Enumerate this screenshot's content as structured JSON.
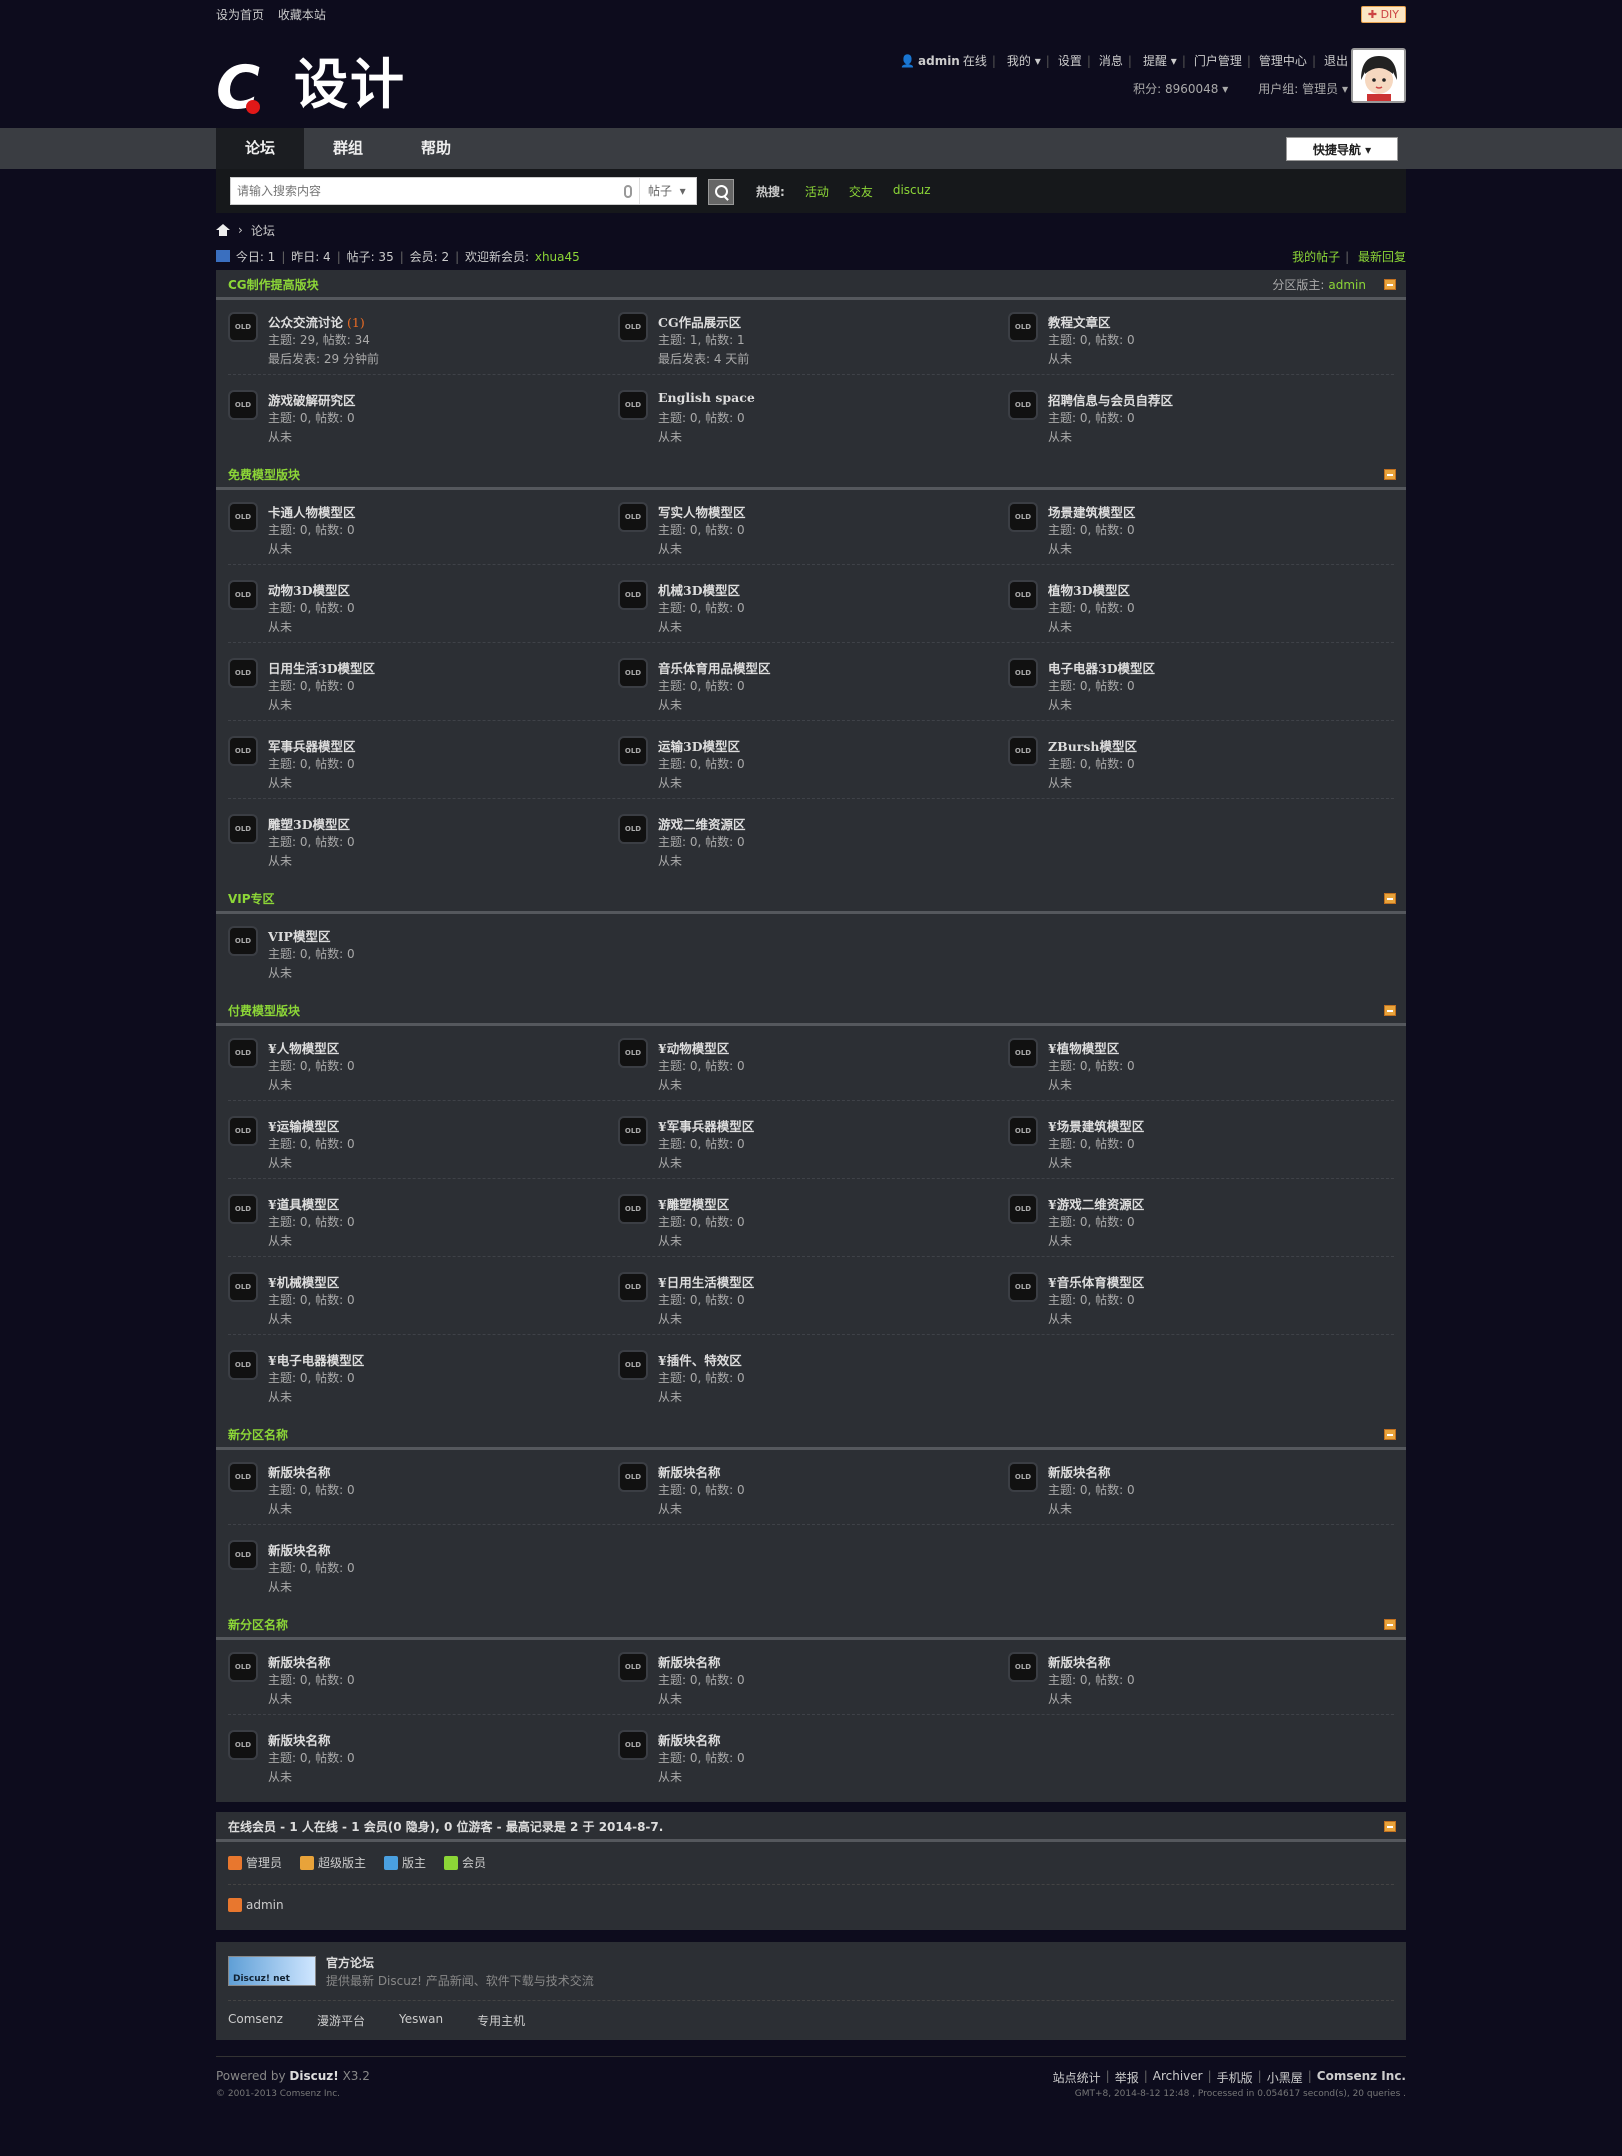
{
  "topbar": {
    "set_home": "设为首页",
    "bookmark": "收藏本站",
    "diy": "DIY"
  },
  "logo": {
    "mark": "C",
    "text": "设计"
  },
  "user": {
    "name": "admin",
    "status": "在线",
    "my": "我的",
    "settings": "设置",
    "messages": "消息",
    "alerts": "提醒",
    "portal_admin": "门户管理",
    "admin_center": "管理中心",
    "logout": "退出",
    "points": "积分: 8960048",
    "group": "用户组: 管理员"
  },
  "nav": {
    "tabs": [
      "论坛",
      "群组",
      "帮助"
    ],
    "quicknav": "快捷导航"
  },
  "search": {
    "placeholder": "请输入搜索内容",
    "type": "帖子",
    "hot_label": "热搜:",
    "hot": [
      "活动",
      "交友",
      "discuz"
    ]
  },
  "breadcrumb": {
    "sep": "›",
    "current": "论坛"
  },
  "stats": {
    "today": "今日: 1",
    "yesterday": "昨日: 4",
    "posts": "帖子: 35",
    "members": "会员: 2",
    "welcome": "欢迎新会员:",
    "newest": "xhua45",
    "my_posts": "我的帖子",
    "latest": "最新回复"
  },
  "categories": [
    {
      "title": "CG制作提高版块",
      "moderator_label": "分区版主:",
      "moderator": "admin",
      "forums": [
        {
          "name": "公众交流讨论",
          "new": "(1)",
          "meta": "主题: 29, 帖数: 34",
          "last": "最后发表: 29 分钟前"
        },
        {
          "name": "CG作品展示区",
          "new": "",
          "meta": "主题: 1, 帖数: 1",
          "last": "最后发表: 4 天前"
        },
        {
          "name": "教程文章区",
          "new": "",
          "meta": "主题: 0, 帖数: 0",
          "last": "从未"
        },
        {
          "name": "游戏破解研究区",
          "new": "",
          "meta": "主题: 0, 帖数: 0",
          "last": "从未"
        },
        {
          "name": "English space",
          "new": "",
          "meta": "主题: 0, 帖数: 0",
          "last": "从未"
        },
        {
          "name": "招聘信息与会员自荐区",
          "new": "",
          "meta": "主题: 0, 帖数: 0",
          "last": "从未"
        }
      ]
    },
    {
      "title": "免费模型版块",
      "moderator_label": "",
      "moderator": "",
      "forums": [
        {
          "name": "卡通人物模型区",
          "new": "",
          "meta": "主题: 0, 帖数: 0",
          "last": "从未"
        },
        {
          "name": "写实人物模型区",
          "new": "",
          "meta": "主题: 0, 帖数: 0",
          "last": "从未"
        },
        {
          "name": "场景建筑模型区",
          "new": "",
          "meta": "主题: 0, 帖数: 0",
          "last": "从未"
        },
        {
          "name": "动物3D模型区",
          "new": "",
          "meta": "主题: 0, 帖数: 0",
          "last": "从未"
        },
        {
          "name": "机械3D模型区",
          "new": "",
          "meta": "主题: 0, 帖数: 0",
          "last": "从未"
        },
        {
          "name": "植物3D模型区",
          "new": "",
          "meta": "主题: 0, 帖数: 0",
          "last": "从未"
        },
        {
          "name": "日用生活3D模型区",
          "new": "",
          "meta": "主题: 0, 帖数: 0",
          "last": "从未"
        },
        {
          "name": "音乐体育用品模型区",
          "new": "",
          "meta": "主题: 0, 帖数: 0",
          "last": "从未"
        },
        {
          "name": "电子电器3D模型区",
          "new": "",
          "meta": "主题: 0, 帖数: 0",
          "last": "从未"
        },
        {
          "name": "军事兵器模型区",
          "new": "",
          "meta": "主题: 0, 帖数: 0",
          "last": "从未"
        },
        {
          "name": "运输3D模型区",
          "new": "",
          "meta": "主题: 0, 帖数: 0",
          "last": "从未"
        },
        {
          "name": "ZBursh模型区",
          "new": "",
          "meta": "主题: 0, 帖数: 0",
          "last": "从未"
        },
        {
          "name": "雕塑3D模型区",
          "new": "",
          "meta": "主题: 0, 帖数: 0",
          "last": "从未"
        },
        {
          "name": "游戏二维资源区",
          "new": "",
          "meta": "主题: 0, 帖数: 0",
          "last": "从未"
        }
      ]
    },
    {
      "title": "VIP专区",
      "moderator_label": "",
      "moderator": "",
      "forums": [
        {
          "name": "VIP模型区",
          "new": "",
          "meta": "主题: 0, 帖数: 0",
          "last": "从未"
        }
      ]
    },
    {
      "title": "付费模型版块",
      "moderator_label": "",
      "moderator": "",
      "forums": [
        {
          "name": "¥人物模型区",
          "new": "",
          "meta": "主题: 0, 帖数: 0",
          "last": "从未"
        },
        {
          "name": "¥动物模型区",
          "new": "",
          "meta": "主题: 0, 帖数: 0",
          "last": "从未"
        },
        {
          "name": "¥植物模型区",
          "new": "",
          "meta": "主题: 0, 帖数: 0",
          "last": "从未"
        },
        {
          "name": "¥运输模型区",
          "new": "",
          "meta": "主题: 0, 帖数: 0",
          "last": "从未"
        },
        {
          "name": "¥军事兵器模型区",
          "new": "",
          "meta": "主题: 0, 帖数: 0",
          "last": "从未"
        },
        {
          "name": "¥场景建筑模型区",
          "new": "",
          "meta": "主题: 0, 帖数: 0",
          "last": "从未"
        },
        {
          "name": "¥道具模型区",
          "new": "",
          "meta": "主题: 0, 帖数: 0",
          "last": "从未"
        },
        {
          "name": "¥雕塑模型区",
          "new": "",
          "meta": "主题: 0, 帖数: 0",
          "last": "从未"
        },
        {
          "name": "¥游戏二维资源区",
          "new": "",
          "meta": "主题: 0, 帖数: 0",
          "last": "从未"
        },
        {
          "name": "¥机械模型区",
          "new": "",
          "meta": "主题: 0, 帖数: 0",
          "last": "从未"
        },
        {
          "name": "¥日用生活模型区",
          "new": "",
          "meta": "主题: 0, 帖数: 0",
          "last": "从未"
        },
        {
          "name": "¥音乐体育模型区",
          "new": "",
          "meta": "主题: 0, 帖数: 0",
          "last": "从未"
        },
        {
          "name": "¥电子电器模型区",
          "new": "",
          "meta": "主题: 0, 帖数: 0",
          "last": "从未"
        },
        {
          "name": "¥插件、特效区",
          "new": "",
          "meta": "主题: 0, 帖数: 0",
          "last": "从未"
        }
      ]
    },
    {
      "title": "新分区名称",
      "moderator_label": "",
      "moderator": "",
      "forums": [
        {
          "name": "新版块名称",
          "new": "",
          "meta": "主题: 0, 帖数: 0",
          "last": "从未"
        },
        {
          "name": "新版块名称",
          "new": "",
          "meta": "主题: 0, 帖数: 0",
          "last": "从未"
        },
        {
          "name": "新版块名称",
          "new": "",
          "meta": "主题: 0, 帖数: 0",
          "last": "从未"
        },
        {
          "name": "新版块名称",
          "new": "",
          "meta": "主题: 0, 帖数: 0",
          "last": "从未"
        }
      ]
    },
    {
      "title": "新分区名称",
      "moderator_label": "",
      "moderator": "",
      "forums": [
        {
          "name": "新版块名称",
          "new": "",
          "meta": "主题: 0, 帖数: 0",
          "last": "从未"
        },
        {
          "name": "新版块名称",
          "new": "",
          "meta": "主题: 0, 帖数: 0",
          "last": "从未"
        },
        {
          "name": "新版块名称",
          "new": "",
          "meta": "主题: 0, 帖数: 0",
          "last": "从未"
        },
        {
          "name": "新版块名称",
          "new": "",
          "meta": "主题: 0, 帖数: 0",
          "last": "从未"
        },
        {
          "name": "新版块名称",
          "new": "",
          "meta": "主题: 0, 帖数: 0",
          "last": "从未"
        }
      ]
    }
  ],
  "online": {
    "title": "在线会员 - 1 人在线 - 1 会员(0 隐身), 0 位游客 - 最高记录是 2 于 2014-8-7.",
    "legend": [
      {
        "label": "管理员",
        "color": "#e8772e"
      },
      {
        "label": "超级版主",
        "color": "#e8a33a"
      },
      {
        "label": "版主",
        "color": "#4aa0e0"
      },
      {
        "label": "会员",
        "color": "#8cd637"
      }
    ],
    "user": "admin"
  },
  "friend_links": {
    "logo_text": "Discuz! net",
    "name": "官方论坛",
    "desc": "提供最新 Discuz! 产品新闻、软件下载与技术交流",
    "links": [
      "Comsenz",
      "漫游平台",
      "Yeswan",
      "专用主机"
    ]
  },
  "footer": {
    "powered": "Powered by",
    "product": "Discuz!",
    "version": "X3.2",
    "copyright": "© 2001-2013 Comsenz Inc.",
    "links": [
      "站点统计",
      "举报",
      "Archiver",
      "手机版",
      "小黑屋"
    ],
    "company": "Comsenz Inc.",
    "gmt": "GMT+8, 2014-8-12 12:48 , Processed in 0.054617 second(s), 20 queries ."
  }
}
